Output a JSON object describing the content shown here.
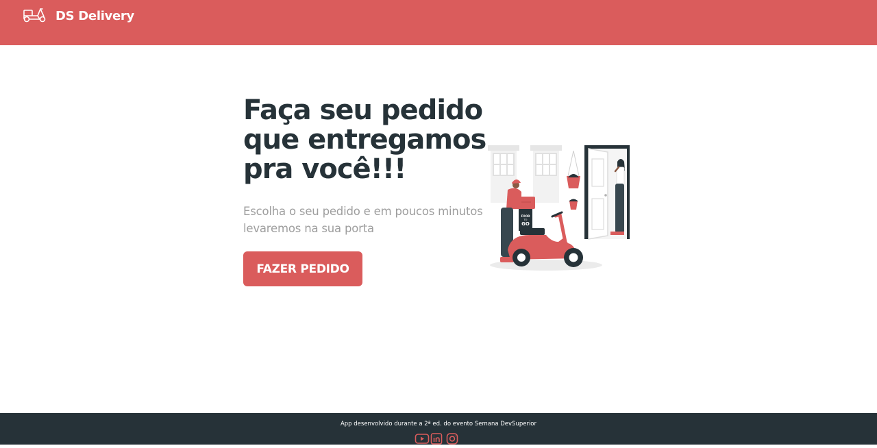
{
  "colors": {
    "primary": "#DA5C5C",
    "dark": "#263238",
    "secondary_text": "#9E9E9E"
  },
  "navbar": {
    "brand_text": "DS Delivery",
    "brand_icon": "scooter-icon"
  },
  "hero": {
    "title_lines": [
      "Faça seu pedido",
      "que entregamos",
      "pra você!!!"
    ],
    "subtitle_lines": [
      "Escolha o seu pedido e em poucos minutos",
      "levaremos na sua porta"
    ],
    "cta_label": "FAZER PEDIDO",
    "illustration": {
      "box_text_top": "FOOD",
      "box_text_mid": "TO",
      "box_text_bottom": "GO"
    }
  },
  "footer": {
    "text": "App desenvolvido durante a 2ª ed. do evento Semana DevSuperior",
    "social_icons": [
      "youtube-icon",
      "linkedin-icon",
      "instagram-icon"
    ]
  }
}
